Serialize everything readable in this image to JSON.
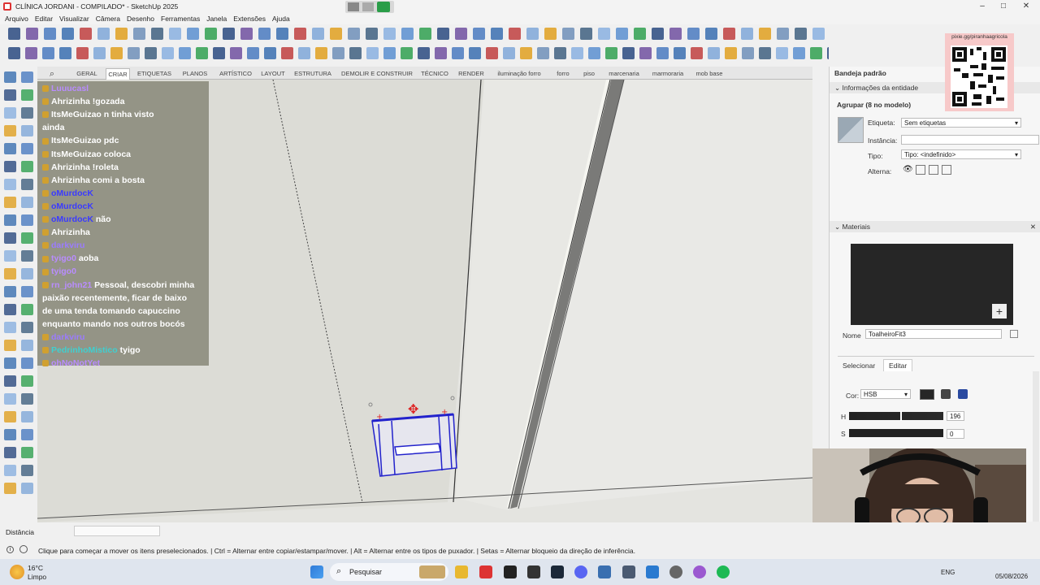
{
  "window": {
    "title": "CLÍNICA JORDANI - COMPILADO* - SketchUp 2025",
    "min": "–",
    "max": "□",
    "close": "✕"
  },
  "menu": [
    "Arquivo",
    "Editar",
    "Visualizar",
    "Câmera",
    "Desenho",
    "Ferramentas",
    "Janela",
    "Extensões",
    "Ajuda"
  ],
  "tabs": {
    "search": "⌕",
    "items": [
      "GERAL",
      "CRIAR",
      "ETIQUETAS",
      "PLANOS",
      "ARTÍSTICO",
      "LAYOUT",
      "ESTRUTURA",
      "DEMOLIR E CONSTRUIR",
      "TÉCNICO",
      "RENDER",
      "iluminação forro",
      "forro",
      "piso",
      "marcenaria",
      "marmoraria",
      "mob base"
    ],
    "active": "CRIAR"
  },
  "chat": [
    {
      "name": "Luuucasl",
      "msg": "",
      "color": "#b98cff"
    },
    {
      "name": "Ahrizinha",
      "msg": "!gozada",
      "color": "#ffffff"
    },
    {
      "name": "ItsMeGuizao",
      "msg": "n tinha visto",
      "color": "#ffffff"
    },
    {
      "name": "",
      "msg": "ainda",
      "color": "#ffffff"
    },
    {
      "name": "ItsMeGuizao",
      "msg": "pdc",
      "color": "#ffffff"
    },
    {
      "name": "ItsMeGuizao",
      "msg": "coloca",
      "color": "#ffffff"
    },
    {
      "name": "Ahrizinha",
      "msg": "!roleta",
      "color": "#ffffff"
    },
    {
      "name": "Ahrizinha",
      "msg": "comi a bosta",
      "color": "#ffffff"
    },
    {
      "name": "oMurdocK",
      "msg": "",
      "color": "#3a3aff"
    },
    {
      "name": "oMurdocK",
      "msg": "",
      "color": "#3a3aff"
    },
    {
      "name": "oMurdocK",
      "msg": "não",
      "color": "#3a3aff"
    },
    {
      "name": "Ahrizinha",
      "msg": "",
      "color": "#ffffff"
    },
    {
      "name": "darkviru",
      "msg": "",
      "color": "#9b7bff"
    },
    {
      "name": "tyigo0",
      "msg": "aoba",
      "color": "#b98cff"
    },
    {
      "name": "tyigo0",
      "msg": "",
      "color": "#b98cff"
    },
    {
      "name": "rn_john21",
      "msg": "Pessoal, descobri minha",
      "color": "#b98cff"
    },
    {
      "name": "",
      "msg": "paixão recentemente, ficar de baixo",
      "color": "#ffffff"
    },
    {
      "name": "",
      "msg": "de uma tenda tomando capuccino",
      "color": "#ffffff"
    },
    {
      "name": "",
      "msg": "enquanto mando nos outros bocós",
      "color": "#ffffff"
    },
    {
      "name": "darkviru",
      "msg": "",
      "color": "#9b7bff"
    },
    {
      "name": "PedrinhoMistico",
      "msg": "tyigo",
      "color": "#3fd0d0"
    },
    {
      "name": "ohNoNotYet",
      "msg": "",
      "color": "#b98cff"
    }
  ],
  "right": {
    "title": "Bandeja padrão",
    "entity_section": "Informações da entidade",
    "group_label": "Agrupar (8 no modelo)",
    "etiqueta_label": "Etiqueta:",
    "etiqueta_value": "Sem etiquetas",
    "instancia_label": "Instância:",
    "instancia_value": "",
    "tipo_label": "Tipo:",
    "tipo_value": "Tipo: <indefinido>",
    "alterna_label": "Alterna:",
    "materials_section": "Materiais",
    "nome_label": "Nome",
    "nome_value": "ToalheiroFit3",
    "tab_select": "Selecionar",
    "tab_edit": "Editar",
    "cor_label": "Cor:",
    "cor_value": "HSB",
    "h_label": "H",
    "h_value": "196",
    "s_label": "S",
    "s_value": "0",
    "swatch_color": "#262626"
  },
  "qr": {
    "url": "pixie.gg/piranhaagricola"
  },
  "status": {
    "distancia_label": "Distância",
    "hint": "Clique para começar a mover os itens preselecionados. | Ctrl = Alternar entre copiar/estampar/mover. | Alt = Alternar entre os tipos de puxador. | Setas = Alternar bloqueio da direção de inferência."
  },
  "taskbar": {
    "temp": "16°C",
    "weather": "Limpo",
    "search": "Pesquisar",
    "lang": "ENG",
    "date": "05/08/2026"
  }
}
